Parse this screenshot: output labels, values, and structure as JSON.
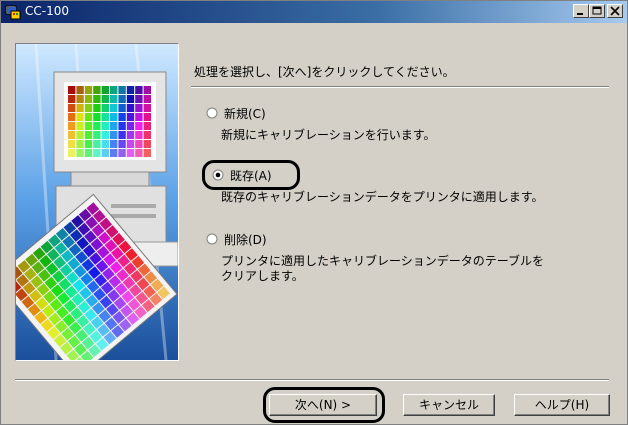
{
  "window": {
    "title": "CC-100",
    "minimize_glyph": "_",
    "restore_glyph": "□",
    "close_glyph": "×"
  },
  "instruction": "処理を選択し、[次へ]をクリックしてください。",
  "options": [
    {
      "label": "新規(C)",
      "description": [
        "新規にキャリブレーションを行います。"
      ],
      "selected": false
    },
    {
      "label": "既存(A)",
      "description": [
        "既存のキャリブレーションデータをプリンタに適用します。"
      ],
      "selected": true
    },
    {
      "label": "削除(D)",
      "description": [
        "プリンタに適用したキャリブレーションデータのテーブルを",
        "クリアします。"
      ],
      "selected": false
    }
  ],
  "buttons": {
    "next": "次へ(N) >",
    "cancel": "キャンセル",
    "help": "ヘルプ(H)"
  },
  "colors": {
    "titlebar_start": "#0a246a",
    "titlebar_end": "#a6caf0",
    "dialog_face": "#d4d0c8",
    "highlight": "#000000"
  }
}
